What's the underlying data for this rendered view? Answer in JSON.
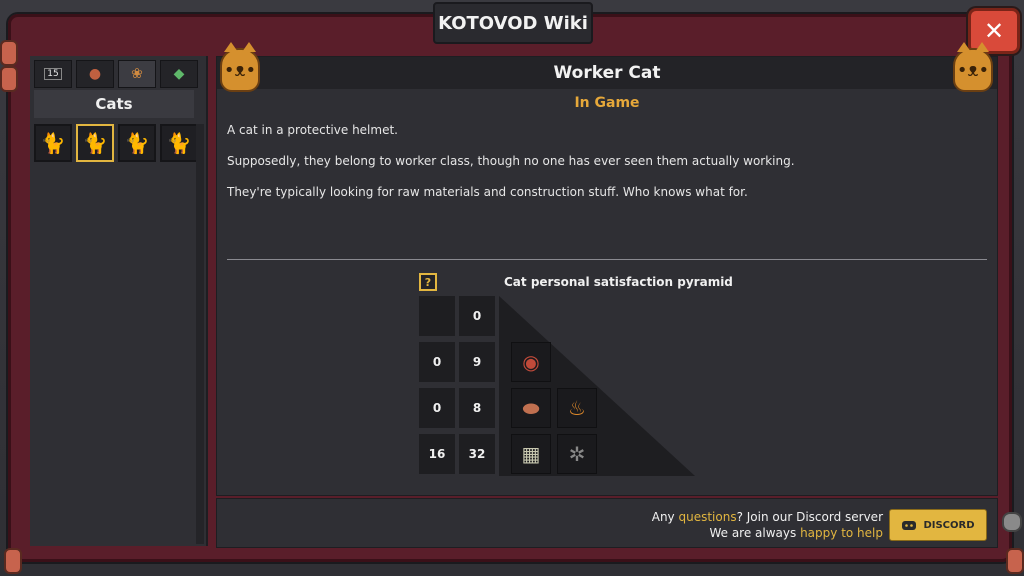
{
  "window": {
    "title": "KOTOVOD Wiki",
    "close_icon": "✕"
  },
  "sidebar": {
    "tabs": [
      {
        "name": "calendar-tab-icon",
        "badge": "15"
      },
      {
        "name": "items-tab-icon",
        "badge": ""
      },
      {
        "name": "cats-tab-icon",
        "badge": ""
      },
      {
        "name": "crafting-tab-icon",
        "badge": ""
      }
    ],
    "section_title": "Cats",
    "cats": [
      "cat-icon",
      "worker-cat-icon",
      "cat-icon",
      "cat-icon"
    ],
    "selected_index": 1
  },
  "article": {
    "title": "Worker Cat",
    "subtitle": "In Game",
    "paragraphs": [
      "A cat in a protective helmet.",
      "Supposedly, they belong to worker class, though no one has ever seen them actually working.",
      "They're typically looking for raw materials and construction stuff. Who knows what for."
    ]
  },
  "pyramid": {
    "help": "?",
    "title": "Cat personal satisfaction pyramid",
    "rows": [
      {
        "left": "",
        "right": "0",
        "items": []
      },
      {
        "left": "0",
        "right": "9",
        "items": [
          "ring-cake-icon"
        ]
      },
      {
        "left": "0",
        "right": "8",
        "items": [
          "wood-log-icon",
          "fire-flame-icon"
        ]
      },
      {
        "left": "16",
        "right": "32",
        "items": [
          "stone-block-icon",
          "metal-scrap-icon"
        ]
      }
    ]
  },
  "footer": {
    "line1_a": "Any ",
    "line1_hl": "questions",
    "line1_b": "? Join our Discord server",
    "line2_a": "We are always ",
    "line2_hl": "happy to help",
    "discord_label": "DISCORD"
  },
  "colors": {
    "accent": "#e2b640",
    "frame": "#5a1e2a",
    "close": "#d94a3a",
    "subtitle": "#e6a83a"
  }
}
